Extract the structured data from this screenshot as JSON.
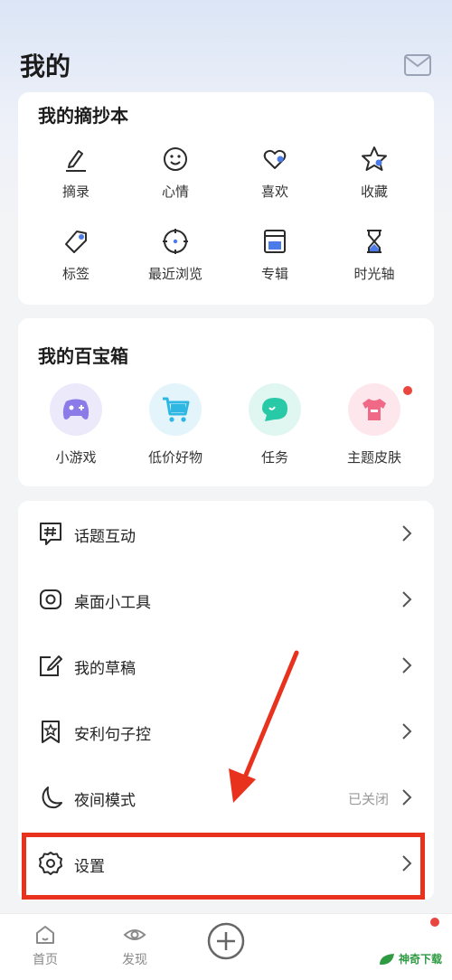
{
  "header": {
    "title": "我的",
    "mail_icon": "mail-icon"
  },
  "notebook": {
    "title": "我的摘抄本",
    "items": [
      {
        "label": "摘录",
        "icon": "pencil-icon"
      },
      {
        "label": "心情",
        "icon": "smiley-icon"
      },
      {
        "label": "喜欢",
        "icon": "heart-icon"
      },
      {
        "label": "收藏",
        "icon": "star-icon"
      },
      {
        "label": "标签",
        "icon": "tag-icon"
      },
      {
        "label": "最近浏览",
        "icon": "clock-icon"
      },
      {
        "label": "专辑",
        "icon": "album-icon"
      },
      {
        "label": "时光轴",
        "icon": "hourglass-icon"
      }
    ]
  },
  "toolbox": {
    "title": "我的百宝箱",
    "items": [
      {
        "label": "小游戏",
        "icon": "gamepad-icon",
        "color": "#8a7be8"
      },
      {
        "label": "低价好物",
        "icon": "cart-icon",
        "color": "#2fb7e4"
      },
      {
        "label": "任务",
        "icon": "chat-bubble-icon",
        "color": "#27c9a7"
      },
      {
        "label": "主题皮肤",
        "icon": "tshirt-icon",
        "color": "#f06a88"
      }
    ]
  },
  "menu": {
    "items": [
      {
        "label": "话题互动",
        "icon": "hashtag-icon",
        "value": ""
      },
      {
        "label": "桌面小工具",
        "icon": "widget-icon",
        "value": ""
      },
      {
        "label": "我的草稿",
        "icon": "draft-icon",
        "value": ""
      },
      {
        "label": "安利句子控",
        "icon": "bookmark-star-icon",
        "value": ""
      },
      {
        "label": "夜间模式",
        "icon": "moon-icon",
        "value": "已关闭"
      },
      {
        "label": "设置",
        "icon": "gear-icon",
        "value": ""
      }
    ]
  },
  "tabbar": {
    "tabs": [
      {
        "label": "首页",
        "icon": "home-icon"
      },
      {
        "label": "发现",
        "icon": "eye-icon"
      }
    ],
    "add_icon": "plus-circle-icon"
  },
  "watermark": {
    "text": "神奇下载"
  },
  "colors": {
    "accent_blue": "#4a7be8",
    "annotation_red": "#e8321e",
    "badge_red": "#e8463f"
  }
}
